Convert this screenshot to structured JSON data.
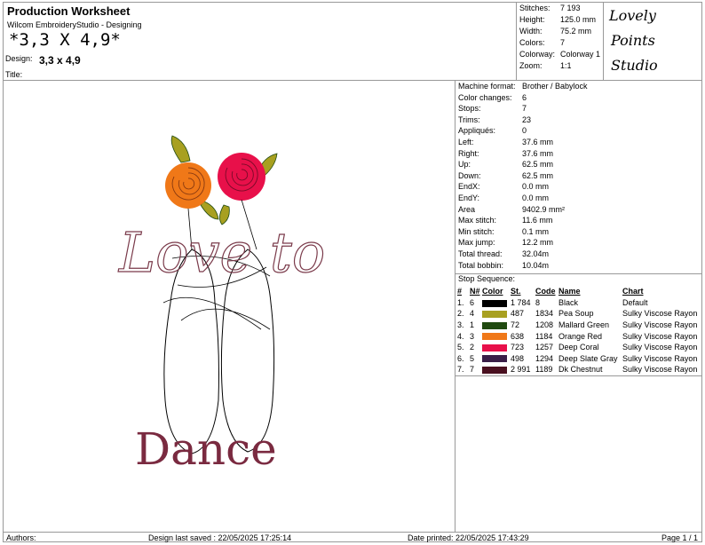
{
  "header": {
    "title": "Production Worksheet",
    "app": "Wilcom EmbroideryStudio - Designing",
    "size_text": "*3,3 X 4,9*",
    "design_label": "Design:",
    "design_value": "3,3 x 4,9",
    "title_label": "Title:"
  },
  "stats": [
    {
      "k": "Stitches:",
      "v": "7 193"
    },
    {
      "k": "Height:",
      "v": "125.0 mm"
    },
    {
      "k": "Width:",
      "v": "75.2 mm"
    },
    {
      "k": "Colors:",
      "v": "7"
    },
    {
      "k": "Colorway:",
      "v": "Colorway 1"
    },
    {
      "k": "Zoom:",
      "v": "1:1"
    }
  ],
  "logo": {
    "line1": "Lovely",
    "line2": "Points",
    "line3": "Studio"
  },
  "artwork": {
    "top_text": "Love to",
    "bottom_text": "Dance"
  },
  "info": [
    {
      "k": "Machine format:",
      "v": "Brother / Babylock"
    },
    {
      "k": "Color changes:",
      "v": "6"
    },
    {
      "k": "Stops:",
      "v": "7"
    },
    {
      "k": "Trims:",
      "v": "23"
    },
    {
      "k": "Appliqués:",
      "v": "0"
    },
    {
      "k": "Left:",
      "v": "37.6 mm"
    },
    {
      "k": "Right:",
      "v": "37.6 mm"
    },
    {
      "k": "Up:",
      "v": "62.5 mm"
    },
    {
      "k": "Down:",
      "v": "62.5 mm"
    },
    {
      "k": "EndX:",
      "v": "0.0 mm"
    },
    {
      "k": "EndY:",
      "v": "0.0 mm"
    },
    {
      "k": "Area",
      "v": "9402.9 mm²"
    },
    {
      "k": "Max stitch:",
      "v": "11.6 mm"
    },
    {
      "k": "Min stitch:",
      "v": "0.1 mm"
    },
    {
      "k": "Max jump:",
      "v": "12.2 mm"
    },
    {
      "k": "Total thread:",
      "v": "32.04m"
    },
    {
      "k": "Total bobbin:",
      "v": "10.04m"
    }
  ],
  "sequence": {
    "title": "Stop Sequence:",
    "headers": {
      "num": "#",
      "n": "N#",
      "color": "Color",
      "st": "St.",
      "code": "Code",
      "name": "Name",
      "chart": "Chart"
    },
    "rows": [
      {
        "num": "1.",
        "n": "6",
        "color": "#000000",
        "st": "1 784",
        "code": "8",
        "name": "Black",
        "chart": "Default"
      },
      {
        "num": "2.",
        "n": "4",
        "color": "#a8a020",
        "st": "487",
        "code": "1834",
        "name": "Pea Soup",
        "chart": "Sulky Viscose Rayon"
      },
      {
        "num": "3.",
        "n": "1",
        "color": "#204a10",
        "st": "72",
        "code": "1208",
        "name": "Mallard Green",
        "chart": "Sulky Viscose Rayon"
      },
      {
        "num": "4.",
        "n": "3",
        "color": "#f07818",
        "st": "638",
        "code": "1184",
        "name": "Orange Red",
        "chart": "Sulky Viscose Rayon"
      },
      {
        "num": "5.",
        "n": "2",
        "color": "#e8104a",
        "st": "723",
        "code": "1257",
        "name": "Deep Coral",
        "chart": "Sulky Viscose Rayon"
      },
      {
        "num": "6.",
        "n": "5",
        "color": "#3a1e48",
        "st": "498",
        "code": "1294",
        "name": "Deep Slate Gray",
        "chart": "Sulky Viscose Rayon"
      },
      {
        "num": "7.",
        "n": "7",
        "color": "#4a1020",
        "st": "2 991",
        "code": "1189",
        "name": "Dk Chestnut",
        "chart": "Sulky Viscose Rayon"
      }
    ]
  },
  "footer": {
    "authors": "Authors:",
    "saved": "Design last saved : 22/05/2025 17:25:14",
    "printed": "Date printed: 22/05/2025 17:43:29",
    "page": "Page 1 / 1"
  }
}
